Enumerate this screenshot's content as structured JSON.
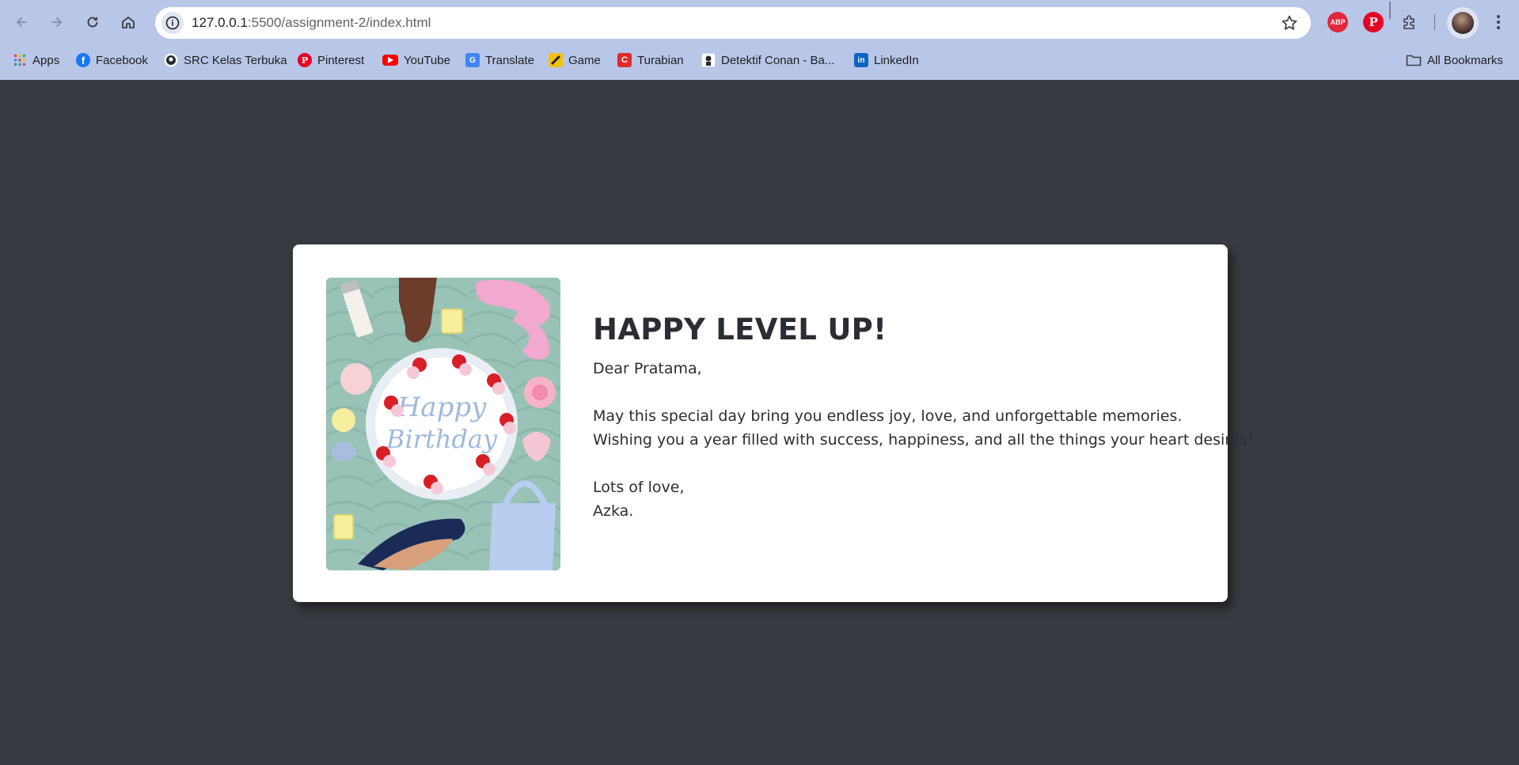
{
  "browser": {
    "url_host": "127.0.0.1",
    "url_path": ":5500/assignment-2/index.html",
    "extensions": {
      "adblock_label": "ABP",
      "pinterest_label": "P"
    }
  },
  "bookmarks": [
    {
      "label": "Apps",
      "icon": "apps-grid-icon"
    },
    {
      "label": "Facebook",
      "icon": "facebook-icon",
      "color": "#1877f2"
    },
    {
      "label": "SRC Kelas Terbuka",
      "icon": "github-icon"
    },
    {
      "label": "Pinterest",
      "icon": "pinterest-icon",
      "color": "#e60023"
    },
    {
      "label": "YouTube",
      "icon": "youtube-icon",
      "color": "#ff0000"
    },
    {
      "label": "Translate",
      "icon": "translate-icon",
      "color": "#4285f4"
    },
    {
      "label": "Game",
      "icon": "game-icon",
      "color": "#f4c20d"
    },
    {
      "label": "Turabian",
      "icon": "turabian-icon",
      "color": "#e02b2b"
    },
    {
      "label": "Detektif Conan - Ba...",
      "icon": "conan-icon"
    },
    {
      "label": "LinkedIn",
      "icon": "linkedin-icon",
      "color": "#0a66c2"
    }
  ],
  "all_bookmarks_label": "All Bookmarks",
  "card": {
    "image_alt": "Happy Birthday",
    "title": "HAPPY LEVEL UP!",
    "greeting": "Dear Pratama,",
    "message_line1": "May this special day bring you endless joy, love, and unforgettable memories.",
    "message_line2": "Wishing you a year filled with success, happiness, and all the things your heart desires!",
    "closing": "Lots of love,",
    "signature": "Azka."
  },
  "colors": {
    "page_background": "#373a40",
    "chrome_background": "#b8c6e8",
    "card_background": "#ffffff",
    "text": "#2a2d33"
  }
}
